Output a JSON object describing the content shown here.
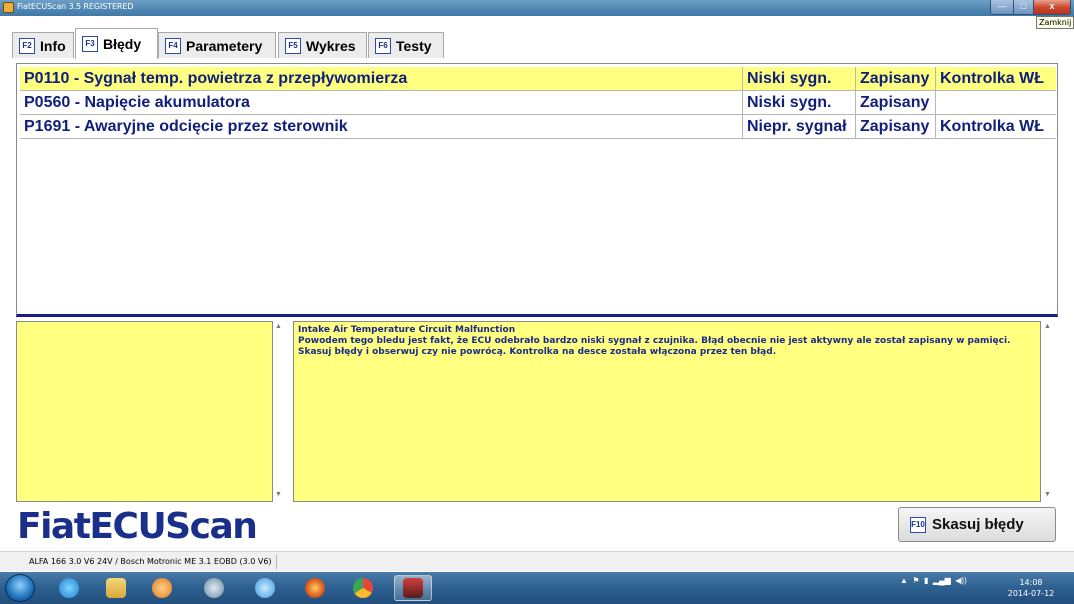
{
  "window": {
    "title": "FiatECUScan 3.5 REGISTERED",
    "close_tooltip": "Zamknij",
    "min_glyph": "—",
    "max_glyph": "□",
    "close_glyph": "x"
  },
  "tabs": [
    {
      "key": "F2",
      "label": "Info",
      "active": false
    },
    {
      "key": "F3",
      "label": "Błędy",
      "active": true
    },
    {
      "key": "F4",
      "label": "Parametery",
      "active": false
    },
    {
      "key": "F5",
      "label": "Wykres",
      "active": false
    },
    {
      "key": "F6",
      "label": "Testy",
      "active": false
    }
  ],
  "faults": [
    {
      "desc": "P0110 - Sygnał temp. powietrza z przepływomierza",
      "type": "Niski sygn.",
      "status": "Zapisany",
      "lamp": "Kontrolka WŁ",
      "highlight": true
    },
    {
      "desc": "P0560 - Napięcie akumulatora",
      "type": "Niski sygn.",
      "status": "Zapisany",
      "lamp": "",
      "highlight": false
    },
    {
      "desc": "P1691 - Awaryjne odcięcie przez sterownik",
      "type": "Niepr. sygnał",
      "status": "Zapisany",
      "lamp": "Kontrolka WŁ",
      "highlight": false
    }
  ],
  "detail": {
    "title": "Intake Air Temperature Circuit Malfunction",
    "body": "Powodem tego bledu jest fakt, że ECU odebrało bardzo niski sygnał z czujnika. Błąd obecnie nie jest aktywny ale został zapisany w pamięci. Skasuj błędy i obserwuj czy nie powrócą. Kontrolka na desce została włączona przez ten błąd."
  },
  "logo": "FiatECUScan",
  "clear_button": {
    "key": "F10",
    "label": "Skasuj błędy"
  },
  "statusbar": {
    "vehicle": "ALFA 166 3.0 V6 24V / Bosch Motronic ME 3.1 EOBD (3.0 V6)"
  },
  "taskbar": {
    "time": "14:08",
    "date": "2014-07-12",
    "apps": [
      "ie-icon",
      "explorer-icon",
      "media-player-icon",
      "camera-icon",
      "skype-icon",
      "firefox-icon",
      "chrome-icon",
      "fiatecuscan-icon"
    ]
  },
  "colors": {
    "accent": "#1a2f8a",
    "highlight": "#ffff80",
    "titlebar": "#4f86b2"
  }
}
